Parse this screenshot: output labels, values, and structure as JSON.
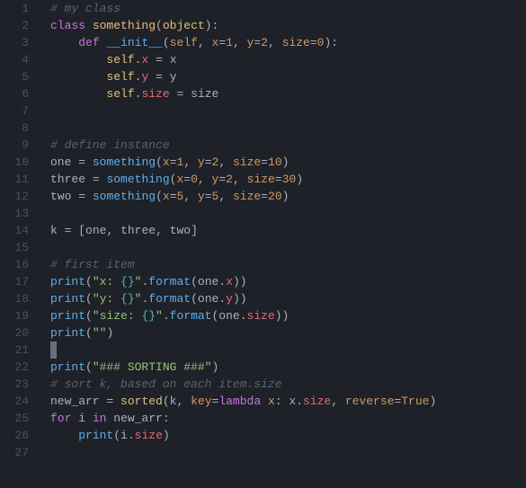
{
  "editor": {
    "lineNumbers": [
      "1",
      "2",
      "3",
      "4",
      "5",
      "6",
      "7",
      "8",
      "9",
      "10",
      "11",
      "12",
      "13",
      "14",
      "15",
      "16",
      "17",
      "18",
      "19",
      "20",
      "21",
      "22",
      "23",
      "24",
      "25",
      "26",
      "27"
    ],
    "cursorLine": 21,
    "lines": [
      [
        {
          "t": "comment",
          "s": "# my class"
        }
      ],
      [
        {
          "t": "keyword",
          "s": "class"
        },
        {
          "t": "text",
          "s": " "
        },
        {
          "t": "class",
          "s": "something"
        },
        {
          "t": "punc",
          "s": "("
        },
        {
          "t": "class",
          "s": "object"
        },
        {
          "t": "punc",
          "s": "):"
        }
      ],
      [
        {
          "t": "text",
          "s": "    "
        },
        {
          "t": "keyword",
          "s": "def"
        },
        {
          "t": "text",
          "s": " "
        },
        {
          "t": "funcdef",
          "s": "__init__"
        },
        {
          "t": "punc",
          "s": "("
        },
        {
          "t": "param",
          "s": "self"
        },
        {
          "t": "punc",
          "s": ", "
        },
        {
          "t": "param",
          "s": "x"
        },
        {
          "t": "op",
          "s": "="
        },
        {
          "t": "number",
          "s": "1"
        },
        {
          "t": "punc",
          "s": ", "
        },
        {
          "t": "param",
          "s": "y"
        },
        {
          "t": "op",
          "s": "="
        },
        {
          "t": "number",
          "s": "2"
        },
        {
          "t": "punc",
          "s": ", "
        },
        {
          "t": "param",
          "s": "size"
        },
        {
          "t": "op",
          "s": "="
        },
        {
          "t": "number",
          "s": "0"
        },
        {
          "t": "punc",
          "s": "):"
        }
      ],
      [
        {
          "t": "text",
          "s": "        "
        },
        {
          "t": "self",
          "s": "self"
        },
        {
          "t": "punc",
          "s": "."
        },
        {
          "t": "ident",
          "s": "x"
        },
        {
          "t": "text",
          "s": " "
        },
        {
          "t": "op",
          "s": "="
        },
        {
          "t": "text",
          "s": " x"
        }
      ],
      [
        {
          "t": "text",
          "s": "        "
        },
        {
          "t": "self",
          "s": "self"
        },
        {
          "t": "punc",
          "s": "."
        },
        {
          "t": "ident",
          "s": "y"
        },
        {
          "t": "text",
          "s": " "
        },
        {
          "t": "op",
          "s": "="
        },
        {
          "t": "text",
          "s": " y"
        }
      ],
      [
        {
          "t": "text",
          "s": "        "
        },
        {
          "t": "self",
          "s": "self"
        },
        {
          "t": "punc",
          "s": "."
        },
        {
          "t": "ident",
          "s": "size"
        },
        {
          "t": "text",
          "s": " "
        },
        {
          "t": "op",
          "s": "="
        },
        {
          "t": "text",
          "s": " size"
        }
      ],
      [],
      [],
      [
        {
          "t": "comment",
          "s": "# define instance"
        }
      ],
      [
        {
          "t": "text",
          "s": "one "
        },
        {
          "t": "op",
          "s": "="
        },
        {
          "t": "text",
          "s": " "
        },
        {
          "t": "func",
          "s": "something"
        },
        {
          "t": "punc",
          "s": "("
        },
        {
          "t": "param",
          "s": "x"
        },
        {
          "t": "op",
          "s": "="
        },
        {
          "t": "number",
          "s": "1"
        },
        {
          "t": "punc",
          "s": ", "
        },
        {
          "t": "param",
          "s": "y"
        },
        {
          "t": "op",
          "s": "="
        },
        {
          "t": "number",
          "s": "2"
        },
        {
          "t": "punc",
          "s": ", "
        },
        {
          "t": "param",
          "s": "size"
        },
        {
          "t": "op",
          "s": "="
        },
        {
          "t": "number",
          "s": "10"
        },
        {
          "t": "punc",
          "s": ")"
        }
      ],
      [
        {
          "t": "text",
          "s": "three "
        },
        {
          "t": "op",
          "s": "="
        },
        {
          "t": "text",
          "s": " "
        },
        {
          "t": "func",
          "s": "something"
        },
        {
          "t": "punc",
          "s": "("
        },
        {
          "t": "param",
          "s": "x"
        },
        {
          "t": "op",
          "s": "="
        },
        {
          "t": "number",
          "s": "0"
        },
        {
          "t": "punc",
          "s": ", "
        },
        {
          "t": "param",
          "s": "y"
        },
        {
          "t": "op",
          "s": "="
        },
        {
          "t": "number",
          "s": "2"
        },
        {
          "t": "punc",
          "s": ", "
        },
        {
          "t": "param",
          "s": "size"
        },
        {
          "t": "op",
          "s": "="
        },
        {
          "t": "number",
          "s": "30"
        },
        {
          "t": "punc",
          "s": ")"
        }
      ],
      [
        {
          "t": "text",
          "s": "two "
        },
        {
          "t": "op",
          "s": "="
        },
        {
          "t": "text",
          "s": " "
        },
        {
          "t": "func",
          "s": "something"
        },
        {
          "t": "punc",
          "s": "("
        },
        {
          "t": "param",
          "s": "x"
        },
        {
          "t": "op",
          "s": "="
        },
        {
          "t": "number",
          "s": "5"
        },
        {
          "t": "punc",
          "s": ", "
        },
        {
          "t": "param",
          "s": "y"
        },
        {
          "t": "op",
          "s": "="
        },
        {
          "t": "number",
          "s": "5"
        },
        {
          "t": "punc",
          "s": ", "
        },
        {
          "t": "param",
          "s": "size"
        },
        {
          "t": "op",
          "s": "="
        },
        {
          "t": "number",
          "s": "20"
        },
        {
          "t": "punc",
          "s": ")"
        }
      ],
      [],
      [
        {
          "t": "text",
          "s": "k "
        },
        {
          "t": "op",
          "s": "="
        },
        {
          "t": "text",
          "s": " "
        },
        {
          "t": "punc",
          "s": "["
        },
        {
          "t": "text",
          "s": "one"
        },
        {
          "t": "punc",
          "s": ", "
        },
        {
          "t": "text",
          "s": "three"
        },
        {
          "t": "punc",
          "s": ", "
        },
        {
          "t": "text",
          "s": "two"
        },
        {
          "t": "punc",
          "s": "]"
        }
      ],
      [],
      [
        {
          "t": "comment",
          "s": "# first item"
        }
      ],
      [
        {
          "t": "func",
          "s": "print"
        },
        {
          "t": "punc",
          "s": "("
        },
        {
          "t": "string",
          "s": "\"x: "
        },
        {
          "t": "esc",
          "s": "{}"
        },
        {
          "t": "string",
          "s": "\""
        },
        {
          "t": "punc",
          "s": "."
        },
        {
          "t": "func",
          "s": "format"
        },
        {
          "t": "punc",
          "s": "("
        },
        {
          "t": "text",
          "s": "one"
        },
        {
          "t": "punc",
          "s": "."
        },
        {
          "t": "ident",
          "s": "x"
        },
        {
          "t": "punc",
          "s": "))"
        }
      ],
      [
        {
          "t": "func",
          "s": "print"
        },
        {
          "t": "punc",
          "s": "("
        },
        {
          "t": "string",
          "s": "\"y: "
        },
        {
          "t": "esc",
          "s": "{}"
        },
        {
          "t": "string",
          "s": "\""
        },
        {
          "t": "punc",
          "s": "."
        },
        {
          "t": "func",
          "s": "format"
        },
        {
          "t": "punc",
          "s": "("
        },
        {
          "t": "text",
          "s": "one"
        },
        {
          "t": "punc",
          "s": "."
        },
        {
          "t": "ident",
          "s": "y"
        },
        {
          "t": "punc",
          "s": "))"
        }
      ],
      [
        {
          "t": "func",
          "s": "print"
        },
        {
          "t": "punc",
          "s": "("
        },
        {
          "t": "string",
          "s": "\"size: "
        },
        {
          "t": "esc",
          "s": "{}"
        },
        {
          "t": "string",
          "s": "\""
        },
        {
          "t": "punc",
          "s": "."
        },
        {
          "t": "func",
          "s": "format"
        },
        {
          "t": "punc",
          "s": "("
        },
        {
          "t": "text",
          "s": "one"
        },
        {
          "t": "punc",
          "s": "."
        },
        {
          "t": "ident",
          "s": "size"
        },
        {
          "t": "punc",
          "s": "))"
        }
      ],
      [
        {
          "t": "func",
          "s": "print"
        },
        {
          "t": "punc",
          "s": "("
        },
        {
          "t": "string",
          "s": "\"\""
        },
        {
          "t": "punc",
          "s": ")"
        }
      ],
      [],
      [
        {
          "t": "func",
          "s": "print"
        },
        {
          "t": "punc",
          "s": "("
        },
        {
          "t": "string",
          "s": "\"### SORTING ###\""
        },
        {
          "t": "punc",
          "s": ")"
        }
      ],
      [
        {
          "t": "comment",
          "s": "# sort k, based on each item.size"
        }
      ],
      [
        {
          "t": "text",
          "s": "new_arr "
        },
        {
          "t": "op",
          "s": "="
        },
        {
          "t": "text",
          "s": " "
        },
        {
          "t": "builtin",
          "s": "sorted"
        },
        {
          "t": "punc",
          "s": "("
        },
        {
          "t": "text",
          "s": "k"
        },
        {
          "t": "punc",
          "s": ", "
        },
        {
          "t": "param",
          "s": "key"
        },
        {
          "t": "op",
          "s": "="
        },
        {
          "t": "keyword",
          "s": "lambda"
        },
        {
          "t": "text",
          "s": " "
        },
        {
          "t": "param",
          "s": "x"
        },
        {
          "t": "punc",
          "s": ": "
        },
        {
          "t": "text",
          "s": "x"
        },
        {
          "t": "punc",
          "s": "."
        },
        {
          "t": "ident",
          "s": "size"
        },
        {
          "t": "punc",
          "s": ", "
        },
        {
          "t": "param",
          "s": "reverse"
        },
        {
          "t": "op",
          "s": "="
        },
        {
          "t": "const",
          "s": "True"
        },
        {
          "t": "punc",
          "s": ")"
        }
      ],
      [
        {
          "t": "keyword",
          "s": "for"
        },
        {
          "t": "text",
          "s": " i "
        },
        {
          "t": "keyword",
          "s": "in"
        },
        {
          "t": "text",
          "s": " new_arr"
        },
        {
          "t": "punc",
          "s": ":"
        }
      ],
      [
        {
          "t": "text",
          "s": "    "
        },
        {
          "t": "func",
          "s": "print"
        },
        {
          "t": "punc",
          "s": "("
        },
        {
          "t": "text",
          "s": "i"
        },
        {
          "t": "punc",
          "s": "."
        },
        {
          "t": "ident",
          "s": "size"
        },
        {
          "t": "punc",
          "s": ")"
        }
      ],
      []
    ]
  }
}
